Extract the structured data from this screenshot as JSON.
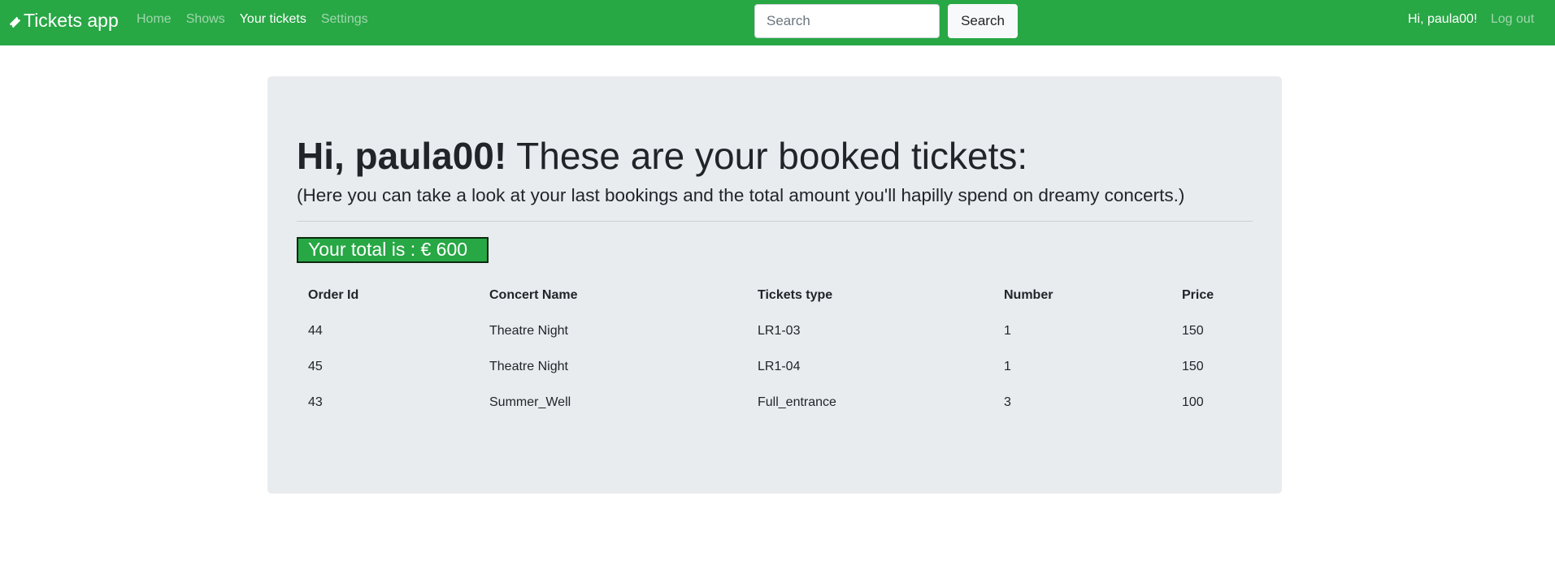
{
  "navbar": {
    "brand": "Tickets app",
    "brand_icon": "ticket-icon",
    "links": [
      {
        "label": "Home",
        "active": false
      },
      {
        "label": "Shows",
        "active": false
      },
      {
        "label": "Your tickets",
        "active": true
      },
      {
        "label": "Settings",
        "active": false
      }
    ],
    "search": {
      "placeholder": "Search",
      "value": "",
      "button_label": "Search"
    },
    "greeting": "Hi, paula00!",
    "logout": "Log out"
  },
  "main": {
    "heading_name": "Hi, paula00!",
    "heading_rest": " These are your booked tickets:",
    "lead": "(Here you can take a look at your last bookings and the total amount you'll hapilly spend on dreamy concerts.)",
    "total_label": "Your total is : € 600",
    "table": {
      "headers": [
        "Order Id",
        "Concert Name",
        "Tickets type",
        "Number",
        "Price"
      ],
      "rows": [
        [
          "44",
          "Theatre Night",
          "LR1-03",
          "1",
          "150"
        ],
        [
          "45",
          "Theatre Night",
          "LR1-04",
          "1",
          "150"
        ],
        [
          "43",
          "Summer_Well",
          "Full_entrance",
          "3",
          "100"
        ]
      ]
    }
  },
  "colors": {
    "navbar_bg": "#28a745",
    "jumbotron_bg": "#e9ecef",
    "total_bg": "#28a745"
  }
}
